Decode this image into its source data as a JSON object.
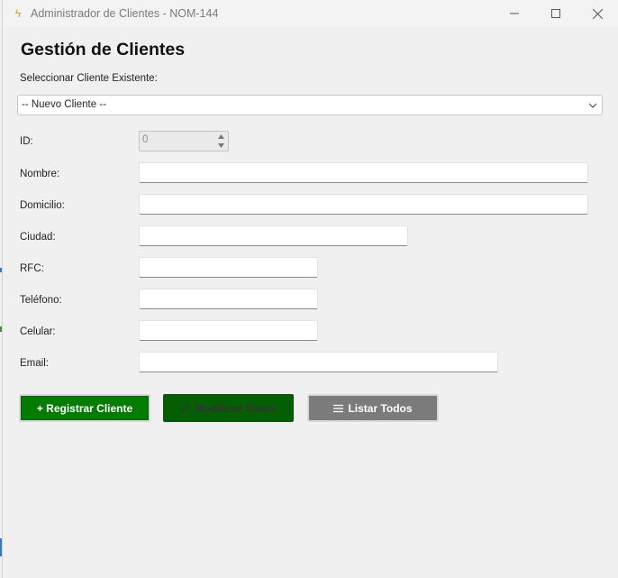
{
  "window": {
    "title": "Administrador de Clientes - NOM-144",
    "icon": "lightning-icon"
  },
  "form": {
    "heading": "Gestión de Clientes",
    "select_label": "Seleccionar Cliente Existente:",
    "select_value": "-- Nuevo Cliente --",
    "fields": {
      "id_label": "ID:",
      "id_value": "0",
      "nombre_label": "Nombre:",
      "domicilio_label": "Domicilio:",
      "ciudad_label": "Ciudad:",
      "rfc_label": "RFC:",
      "telefono_label": "Teléfono:",
      "celular_label": "Celular:",
      "email_label": "Email:"
    }
  },
  "buttons": {
    "register": "+ Registrar Cliente",
    "modify": "Modificar Datos",
    "list": "Listar Todos"
  },
  "colors": {
    "register_bg": "#047c04",
    "modify_bg": "#045f04",
    "list_bg": "#7b7b7b"
  }
}
